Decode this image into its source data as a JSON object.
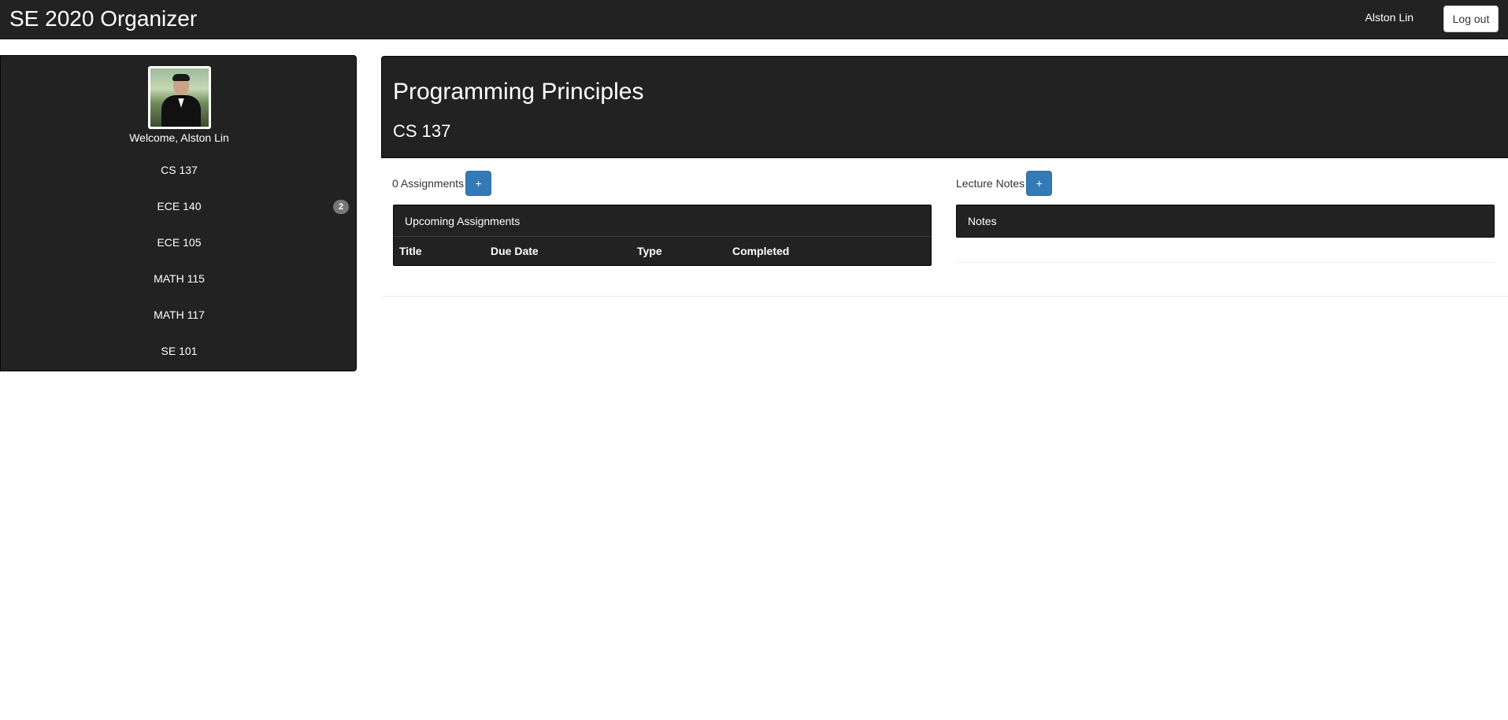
{
  "navbar": {
    "brand": "SE 2020 Organizer",
    "user_name": "Alston Lin",
    "logout_label": "Log out"
  },
  "sidebar": {
    "welcome": "Welcome, Alston Lin",
    "courses": [
      {
        "label": "CS 137",
        "badge": ""
      },
      {
        "label": "ECE 140",
        "badge": "2"
      },
      {
        "label": "ECE 105",
        "badge": ""
      },
      {
        "label": "MATH 115",
        "badge": ""
      },
      {
        "label": "MATH 117",
        "badge": ""
      },
      {
        "label": "SE 101",
        "badge": ""
      }
    ]
  },
  "course": {
    "title": "Programming Principles",
    "code": "CS 137"
  },
  "assignments": {
    "count_label": "0 Assignments",
    "add_label": "+",
    "panel_title": "Upcoming Assignments",
    "columns": [
      "Title",
      "Due Date",
      "Type",
      "Completed"
    ]
  },
  "notes": {
    "label": "Lecture Notes",
    "add_label": "+",
    "panel_title": "Notes"
  },
  "colors": {
    "dark": "#222222",
    "primary": "#337ab7",
    "badge": "#777777"
  }
}
